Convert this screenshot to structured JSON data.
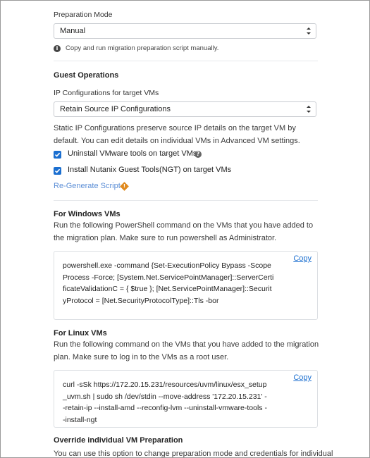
{
  "preparation": {
    "label": "Preparation Mode",
    "selected": "Manual",
    "hint": "Copy and run migration preparation script manually."
  },
  "guest_ops": {
    "title": "Guest Operations",
    "ip_label": "IP Configurations for target VMs",
    "ip_selected": "Retain Source IP Configurations",
    "ip_desc": "Static IP Configurations preserve source IP details on the target VM by default. You can edit details on individual VMs in Advanced VM settings.",
    "uninstall_label": "Uninstall VMware tools on target VMs",
    "ngt_label": "Install Nutanix Guest Tools(NGT) on target VMs",
    "regenerate_label": "Re-Generate Script"
  },
  "windows": {
    "title": "For Windows VMs",
    "desc": "Run the following PowerShell command on the VMs that you have added to the migration plan. Make sure to run powershell as Administrator.",
    "code": "powershell.exe -command {Set-ExecutionPolicy Bypass -Scope Process -Force; [System.Net.ServicePointManager]::ServerCertificateValidationC = { $true }; [Net.ServicePointManager]::SecurityProtocol = [Net.SecurityProtocolType]::Tls -bor",
    "copy_label": "Copy"
  },
  "linux": {
    "title": "For Linux VMs",
    "desc": "Run the following command on the VMs that you have added to the migration plan. Make sure to log in to the VMs as a root user.",
    "code": "curl -sSk https://172.20.15.231/resources/uvm/linux/esx_setup_uvm.sh | sudo sh /dev/stdin --move-address '172.20.15.231' --retain-ip --install-amd --reconfig-lvm --uninstall-vmware-tools --install-ngt",
    "copy_label": "Copy"
  },
  "override": {
    "title": "Override individual VM Preparation",
    "desc": "You can use this option to change preparation mode and credentials for individual"
  },
  "colors": {
    "accent": "#1b6fd0",
    "link_muted": "#5b8ed6",
    "warning": "#e08a1e"
  }
}
